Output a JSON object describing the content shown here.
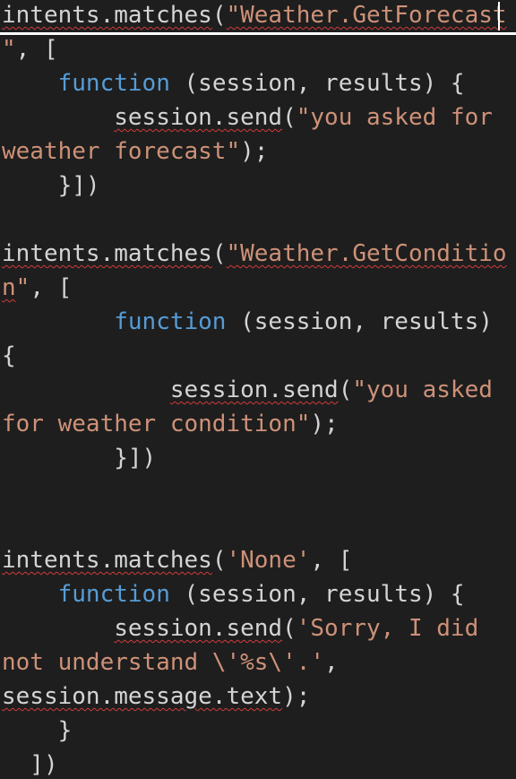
{
  "colors": {
    "background": "#1e1e1e",
    "default": "#d4d4d4",
    "keyword": "#569cd6",
    "string": "#ce9178",
    "squiggle": "#d23b3b"
  },
  "lines": [
    [
      {
        "t": "intents.matches",
        "c": "default",
        "sq": true
      },
      {
        "t": "(",
        "c": "default"
      },
      {
        "t": "\"Weather.GetForecast",
        "c": "string",
        "sq": true
      }
    ],
    [
      {
        "t": "\"",
        "c": "string"
      },
      {
        "t": ", [",
        "c": "default"
      }
    ],
    [
      {
        "t": "    ",
        "c": "default"
      },
      {
        "t": "function",
        "c": "keyword"
      },
      {
        "t": " (session, results) {",
        "c": "default"
      }
    ],
    [
      {
        "t": "        ",
        "c": "default"
      },
      {
        "t": "session.send",
        "c": "default",
        "sq": true
      },
      {
        "t": "(",
        "c": "default"
      },
      {
        "t": "\"you asked for",
        "c": "string"
      }
    ],
    [
      {
        "t": "weather forecast\"",
        "c": "string"
      },
      {
        "t": ");",
        "c": "default"
      }
    ],
    [
      {
        "t": "    }])",
        "c": "default"
      }
    ],
    [],
    [
      {
        "t": "intents.matches",
        "c": "default",
        "sq": true
      },
      {
        "t": "(",
        "c": "default"
      },
      {
        "t": "\"Weather.GetConditio",
        "c": "string",
        "sq": true
      }
    ],
    [
      {
        "t": "n",
        "c": "string",
        "sq": true
      },
      {
        "t": "\"",
        "c": "string"
      },
      {
        "t": ", [",
        "c": "default"
      }
    ],
    [
      {
        "t": "        ",
        "c": "default"
      },
      {
        "t": "function",
        "c": "keyword"
      },
      {
        "t": " (session, results)",
        "c": "default"
      }
    ],
    [
      {
        "t": "{",
        "c": "default"
      }
    ],
    [
      {
        "t": "            ",
        "c": "default"
      },
      {
        "t": "session.send",
        "c": "default",
        "sq": true
      },
      {
        "t": "(",
        "c": "default"
      },
      {
        "t": "\"you asked",
        "c": "string"
      }
    ],
    [
      {
        "t": "for weather condition\"",
        "c": "string"
      },
      {
        "t": ");",
        "c": "default"
      }
    ],
    [
      {
        "t": "        }])",
        "c": "default"
      }
    ],
    [],
    [],
    [
      {
        "t": "intents.matches",
        "c": "default",
        "sq": true
      },
      {
        "t": "(",
        "c": "default"
      },
      {
        "t": "'None'",
        "c": "string"
      },
      {
        "t": ", [",
        "c": "default"
      }
    ],
    [
      {
        "t": "    ",
        "c": "default"
      },
      {
        "t": "function",
        "c": "keyword"
      },
      {
        "t": " (session, results) {",
        "c": "default"
      }
    ],
    [
      {
        "t": "        ",
        "c": "default"
      },
      {
        "t": "session.send",
        "c": "default",
        "sq": true
      },
      {
        "t": "(",
        "c": "default"
      },
      {
        "t": "'Sorry, I did",
        "c": "string"
      }
    ],
    [
      {
        "t": "not understand \\'%s\\'.'",
        "c": "string"
      },
      {
        "t": ",",
        "c": "default"
      }
    ],
    [
      {
        "t": "session.message.text",
        "c": "default",
        "sq": true
      },
      {
        "t": ");",
        "c": "default"
      }
    ],
    [
      {
        "t": "    }",
        "c": "default"
      }
    ],
    [
      {
        "t": "  ])",
        "c": "default"
      }
    ]
  ]
}
